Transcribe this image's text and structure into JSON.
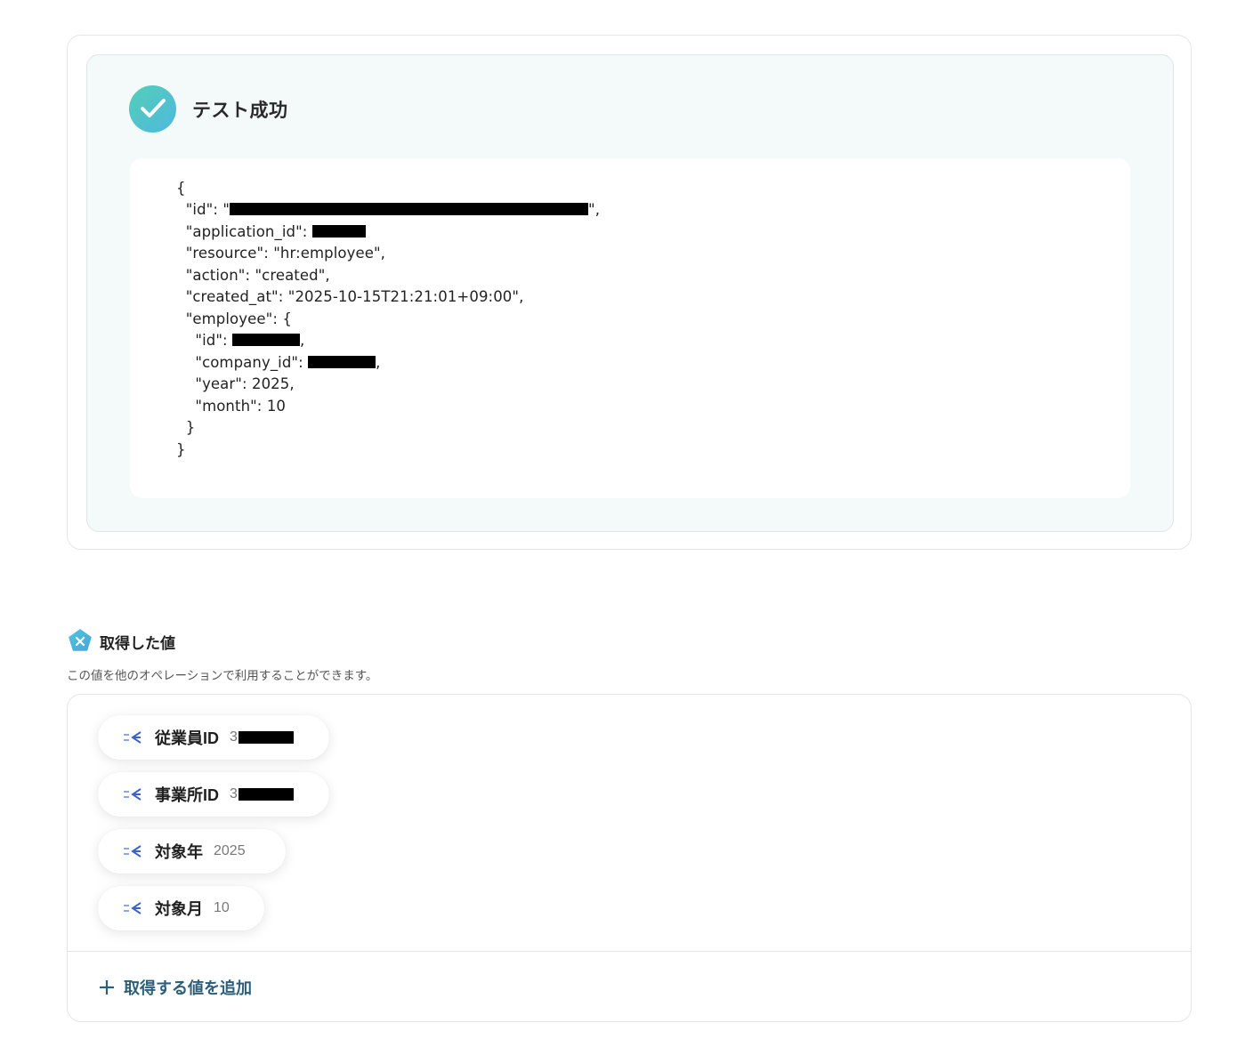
{
  "test_result": {
    "title": "テスト成功",
    "json_lines": [
      "{",
      "  \"id\": \"",
      "  \"application_id\": ",
      "  \"resource\": \"hr:employee\",",
      "  \"action\": \"created\",",
      "  \"created_at\": \"2025-10-15T21:21:01+09:00\",",
      "  \"employee\": {",
      "    \"id\": ",
      "    \"company_id\": ",
      "    \"year\": 2025,",
      "    \"month\": 10",
      "  }",
      "}"
    ]
  },
  "acquired": {
    "title": "取得した値",
    "description": "この値を他のオペレーションで利用することができます。",
    "items": [
      {
        "label": "従業員ID",
        "value": "3"
      },
      {
        "label": "事業所ID",
        "value": "3"
      },
      {
        "label": "対象年",
        "value": "2025"
      },
      {
        "label": "対象月",
        "value": "10"
      }
    ],
    "add_label": "取得する値を追加"
  },
  "colors": {
    "accent": "#2d5f7a",
    "success_start": "#53cfb8",
    "success_end": "#4fb8de",
    "panel_bg": "#f4f9f9"
  },
  "icons": {
    "success": "check-icon",
    "section": "variable-pentagon-icon",
    "chip": "arrow-variable-icon",
    "add": "plus-icon"
  }
}
